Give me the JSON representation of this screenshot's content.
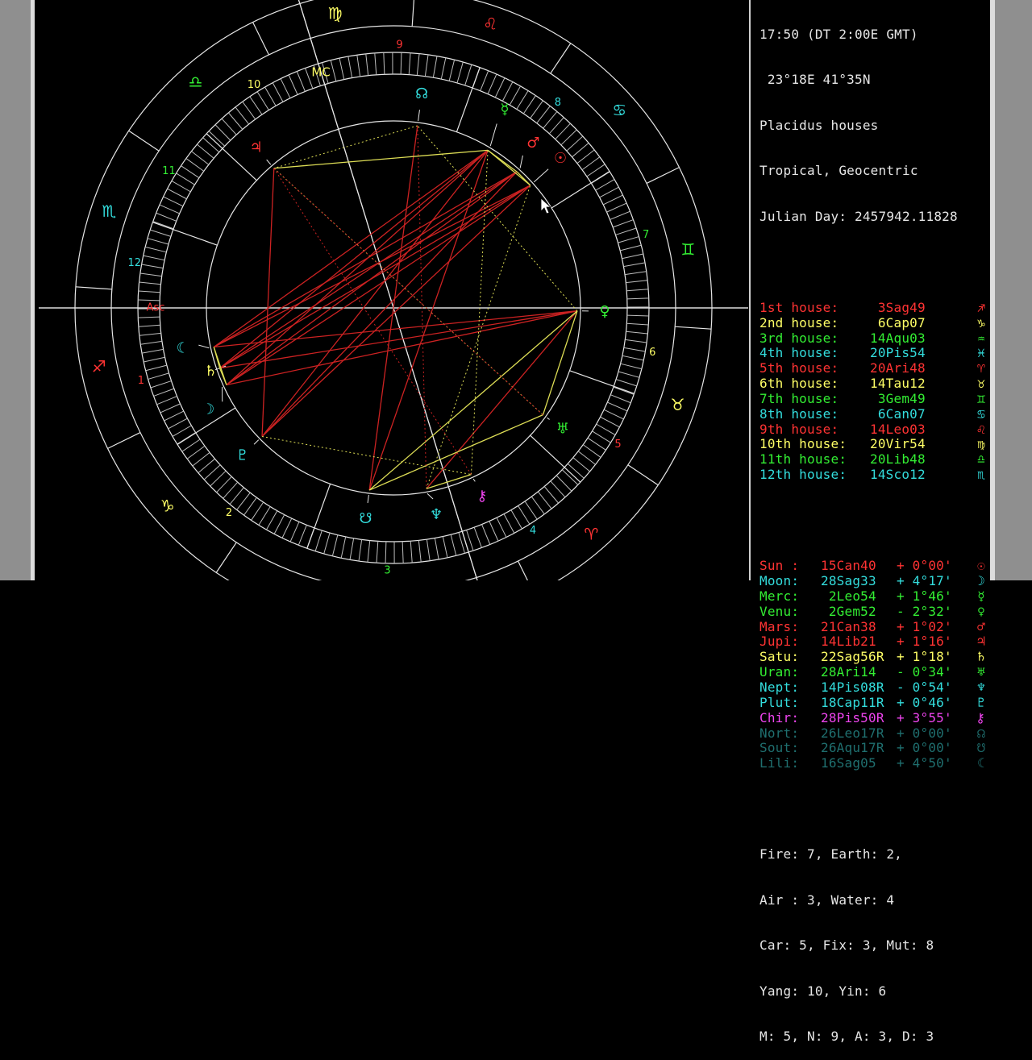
{
  "header": {
    "line1": "17:50 (DT 2:00E GMT)",
    "line2": " 23°18E 41°35N",
    "line3": "Placidus houses",
    "line4": "Tropical, Geocentric",
    "line5": "Julian Day: 2457942.11828"
  },
  "houses": [
    {
      "label": "1st house:",
      "pos": " 3Sag49",
      "glyph": "♐",
      "color": "#ff3333"
    },
    {
      "label": "2nd house:",
      "pos": " 6Cap07",
      "glyph": "♑",
      "color": "#ffff66"
    },
    {
      "label": "3rd house:",
      "pos": "14Aqu03",
      "glyph": "♒",
      "color": "#33ee33"
    },
    {
      "label": "4th house:",
      "pos": "20Pis54",
      "glyph": "♓",
      "color": "#33dddd"
    },
    {
      "label": "5th house:",
      "pos": "20Ari48",
      "glyph": "♈",
      "color": "#ff3333"
    },
    {
      "label": "6th house:",
      "pos": "14Tau12",
      "glyph": "♉",
      "color": "#ffff66"
    },
    {
      "label": "7th house:",
      "pos": " 3Gem49",
      "glyph": "♊",
      "color": "#33ee33"
    },
    {
      "label": "8th house:",
      "pos": " 6Can07",
      "glyph": "♋",
      "color": "#33dddd"
    },
    {
      "label": "9th house:",
      "pos": "14Leo03",
      "glyph": "♌",
      "color": "#ff3333"
    },
    {
      "label": "10th house:",
      "pos": "20Vir54",
      "glyph": "♍",
      "color": "#ffff66"
    },
    {
      "label": "11th house:",
      "pos": "20Lib48",
      "glyph": "♎",
      "color": "#33ee33"
    },
    {
      "label": "12th house:",
      "pos": "14Sco12",
      "glyph": "♏",
      "color": "#33dddd"
    }
  ],
  "planets": [
    {
      "name": "Sun :",
      "pos": "15Can40 ",
      "lat": "+ 0°00'",
      "glyph": "☉",
      "color": "#ff3333"
    },
    {
      "name": "Moon:",
      "pos": "28Sag33 ",
      "lat": "+ 4°17'",
      "glyph": "☽",
      "color": "#33dddd"
    },
    {
      "name": "Merc:",
      "pos": " 2Leo54 ",
      "lat": "+ 1°46'",
      "glyph": "☿",
      "color": "#33ee33"
    },
    {
      "name": "Venu:",
      "pos": " 2Gem52 ",
      "lat": "- 2°32'",
      "glyph": "♀",
      "color": "#33ee33"
    },
    {
      "name": "Mars:",
      "pos": "21Can38 ",
      "lat": "+ 1°02'",
      "glyph": "♂",
      "color": "#ff3333"
    },
    {
      "name": "Jupi:",
      "pos": "14Lib21 ",
      "lat": "+ 1°16'",
      "glyph": "♃",
      "color": "#ff3333"
    },
    {
      "name": "Satu:",
      "pos": "22Sag56R",
      "lat": "+ 1°18'",
      "glyph": "♄",
      "color": "#ffff66"
    },
    {
      "name": "Uran:",
      "pos": "28Ari14 ",
      "lat": "- 0°34'",
      "glyph": "♅",
      "color": "#33ee33"
    },
    {
      "name": "Nept:",
      "pos": "14Pis08R",
      "lat": "- 0°54'",
      "glyph": "♆",
      "color": "#33dddd"
    },
    {
      "name": "Plut:",
      "pos": "18Cap11R",
      "lat": "+ 0°46'",
      "glyph": "♇",
      "color": "#33dddd"
    },
    {
      "name": "Chir:",
      "pos": "28Pis50R",
      "lat": "+ 3°55'",
      "glyph": "⚷",
      "color": "#ee44ee"
    },
    {
      "name": "Nort:",
      "pos": "26Leo17R",
      "lat": "+ 0°00'",
      "glyph": "☊",
      "color": "#1f6f6f"
    },
    {
      "name": "Sout:",
      "pos": "26Aqu17R",
      "lat": "+ 0°00'",
      "glyph": "☋",
      "color": "#1f6f6f"
    },
    {
      "name": "Lili:",
      "pos": "16Sag05 ",
      "lat": "+ 4°50'",
      "glyph": "☾",
      "color": "#1f6f6f"
    }
  ],
  "summary": {
    "line1": "Fire: 7, Earth: 2,",
    "line2": "Air : 3, Water: 4",
    "line3": "Car: 5, Fix: 3, Mut: 8",
    "line4": "Yang: 10, Yin: 6",
    "line5": "M: 5, N: 9, A: 3, D: 3"
  },
  "wheel": {
    "angle_labels": {
      "asc": "Asc",
      "mc": "MC"
    },
    "house_numbers": [
      "1",
      "2",
      "3",
      "4",
      "5",
      "6",
      "7",
      "8",
      "9",
      "10",
      "11",
      "12"
    ],
    "signs": [
      {
        "glyph": "♐",
        "color": "#ff3333"
      },
      {
        "glyph": "♑",
        "color": "#ffff66"
      },
      {
        "glyph": "♒",
        "color": "#33ee33"
      },
      {
        "glyph": "♓",
        "color": "#33dddd"
      },
      {
        "glyph": "♈",
        "color": "#ff3333"
      },
      {
        "glyph": "♉",
        "color": "#ffff66"
      },
      {
        "glyph": "♊",
        "color": "#33ee33"
      },
      {
        "glyph": "♋",
        "color": "#33dddd"
      },
      {
        "glyph": "♌",
        "color": "#ff3333"
      },
      {
        "glyph": "♍",
        "color": "#ffff66"
      },
      {
        "glyph": "♎",
        "color": "#33ee33"
      },
      {
        "glyph": "♏",
        "color": "#33dddd"
      }
    ],
    "planet_glyphs": [
      {
        "glyph": "☉",
        "color": "#ff3333"
      },
      {
        "glyph": "☽",
        "color": "#33dddd"
      },
      {
        "glyph": "☿",
        "color": "#33ee33"
      },
      {
        "glyph": "♀",
        "color": "#33ee33"
      },
      {
        "glyph": "♂",
        "color": "#ff3333"
      },
      {
        "glyph": "♃",
        "color": "#ff3333"
      },
      {
        "glyph": "♄",
        "color": "#ffff66"
      },
      {
        "glyph": "♅",
        "color": "#33ee33"
      },
      {
        "glyph": "♆",
        "color": "#33dddd"
      },
      {
        "glyph": "♇",
        "color": "#33dddd"
      },
      {
        "glyph": "⚷",
        "color": "#ee44ee"
      },
      {
        "glyph": "☊",
        "color": "#33dddd"
      },
      {
        "glyph": "☋",
        "color": "#33dddd"
      },
      {
        "glyph": "☾",
        "color": "#33dddd"
      }
    ]
  }
}
